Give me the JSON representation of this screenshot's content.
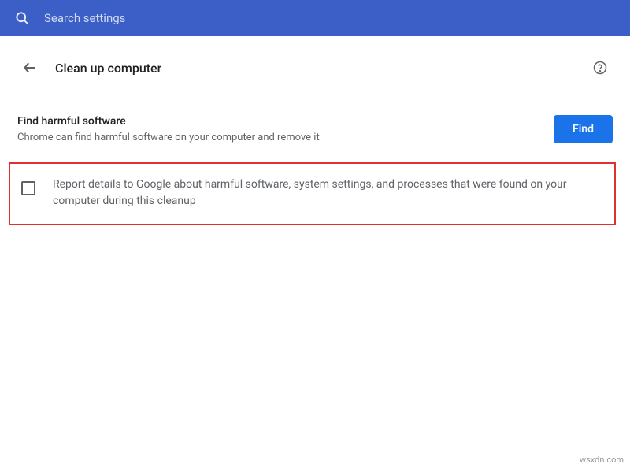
{
  "search": {
    "placeholder": "Search settings"
  },
  "header": {
    "title": "Clean up computer"
  },
  "find_section": {
    "title": "Find harmful software",
    "subtitle": "Chrome can find harmful software on your computer and remove it",
    "button_label": "Find"
  },
  "report_checkbox": {
    "label": "Report details to Google about harmful software, system settings, and processes that were found on your computer during this cleanup"
  },
  "watermark": "wsxdn.com",
  "colors": {
    "header_blue": "#3b5fc7",
    "button_blue": "#1a73e8",
    "highlight_red": "#e03030"
  }
}
